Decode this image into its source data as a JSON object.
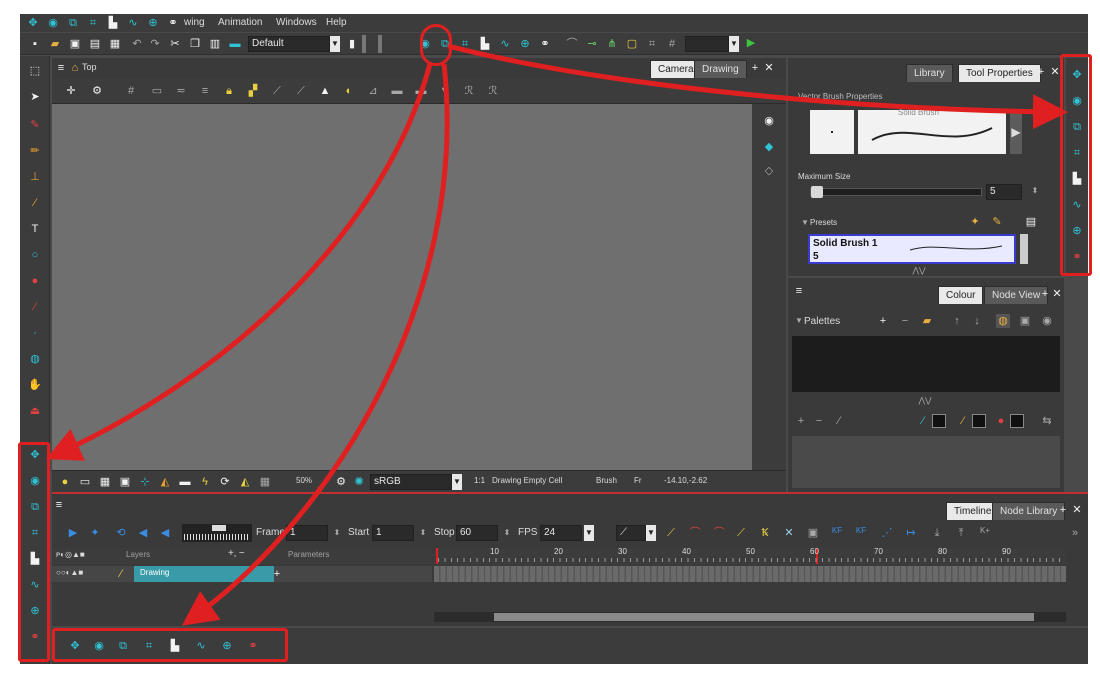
{
  "menu": {
    "items": [
      "wing",
      "Animation",
      "Windows",
      "Help"
    ]
  },
  "toolbar": {
    "workspace": "Default"
  },
  "camera_view": {
    "tabs": [
      "Camera",
      "Drawing"
    ],
    "active_tab": "Camera",
    "title": "Top",
    "zoom": "50%",
    "colorspace": "sRGB",
    "ratio": "1:1",
    "status_cell": "Drawing Empty Cell",
    "status_tool": "Brush",
    "status_fr": "Fr",
    "status_coords": "-14.10,-2.62"
  },
  "tool_properties": {
    "tabs": [
      "Library",
      "Tool Properties"
    ],
    "active_tab": "Tool Properties",
    "section": "Vector Brush Properties",
    "preview_label": "Solid Brush",
    "max_size_label": "Maximum Size",
    "max_size_value": "5",
    "presets_label": "Presets",
    "preset_name": "Solid Brush 1",
    "preset_size": "5"
  },
  "colour": {
    "tabs": [
      "Colour",
      "Node View"
    ],
    "active_tab": "Colour",
    "palettes_label": "Palettes"
  },
  "timeline": {
    "tabs": [
      "Timeline",
      "Node Library"
    ],
    "active_tab": "Timeline",
    "frame_label": "Frame",
    "frame_value": "1",
    "start_label": "Start",
    "start_value": "1",
    "stop_label": "Stop",
    "stop_value": "60",
    "fps_label": "FPS",
    "fps_value": "24",
    "layers_header": "Layers",
    "parameters_header": "Parameters",
    "layer_name": "Drawing",
    "ruler": [
      "10",
      "20",
      "30",
      "40",
      "50",
      "60",
      "70",
      "80",
      "90"
    ]
  },
  "colors": {
    "accent": "#2ec4d6",
    "highlight": "#e02020",
    "ui_bg": "#4a4a4a"
  }
}
